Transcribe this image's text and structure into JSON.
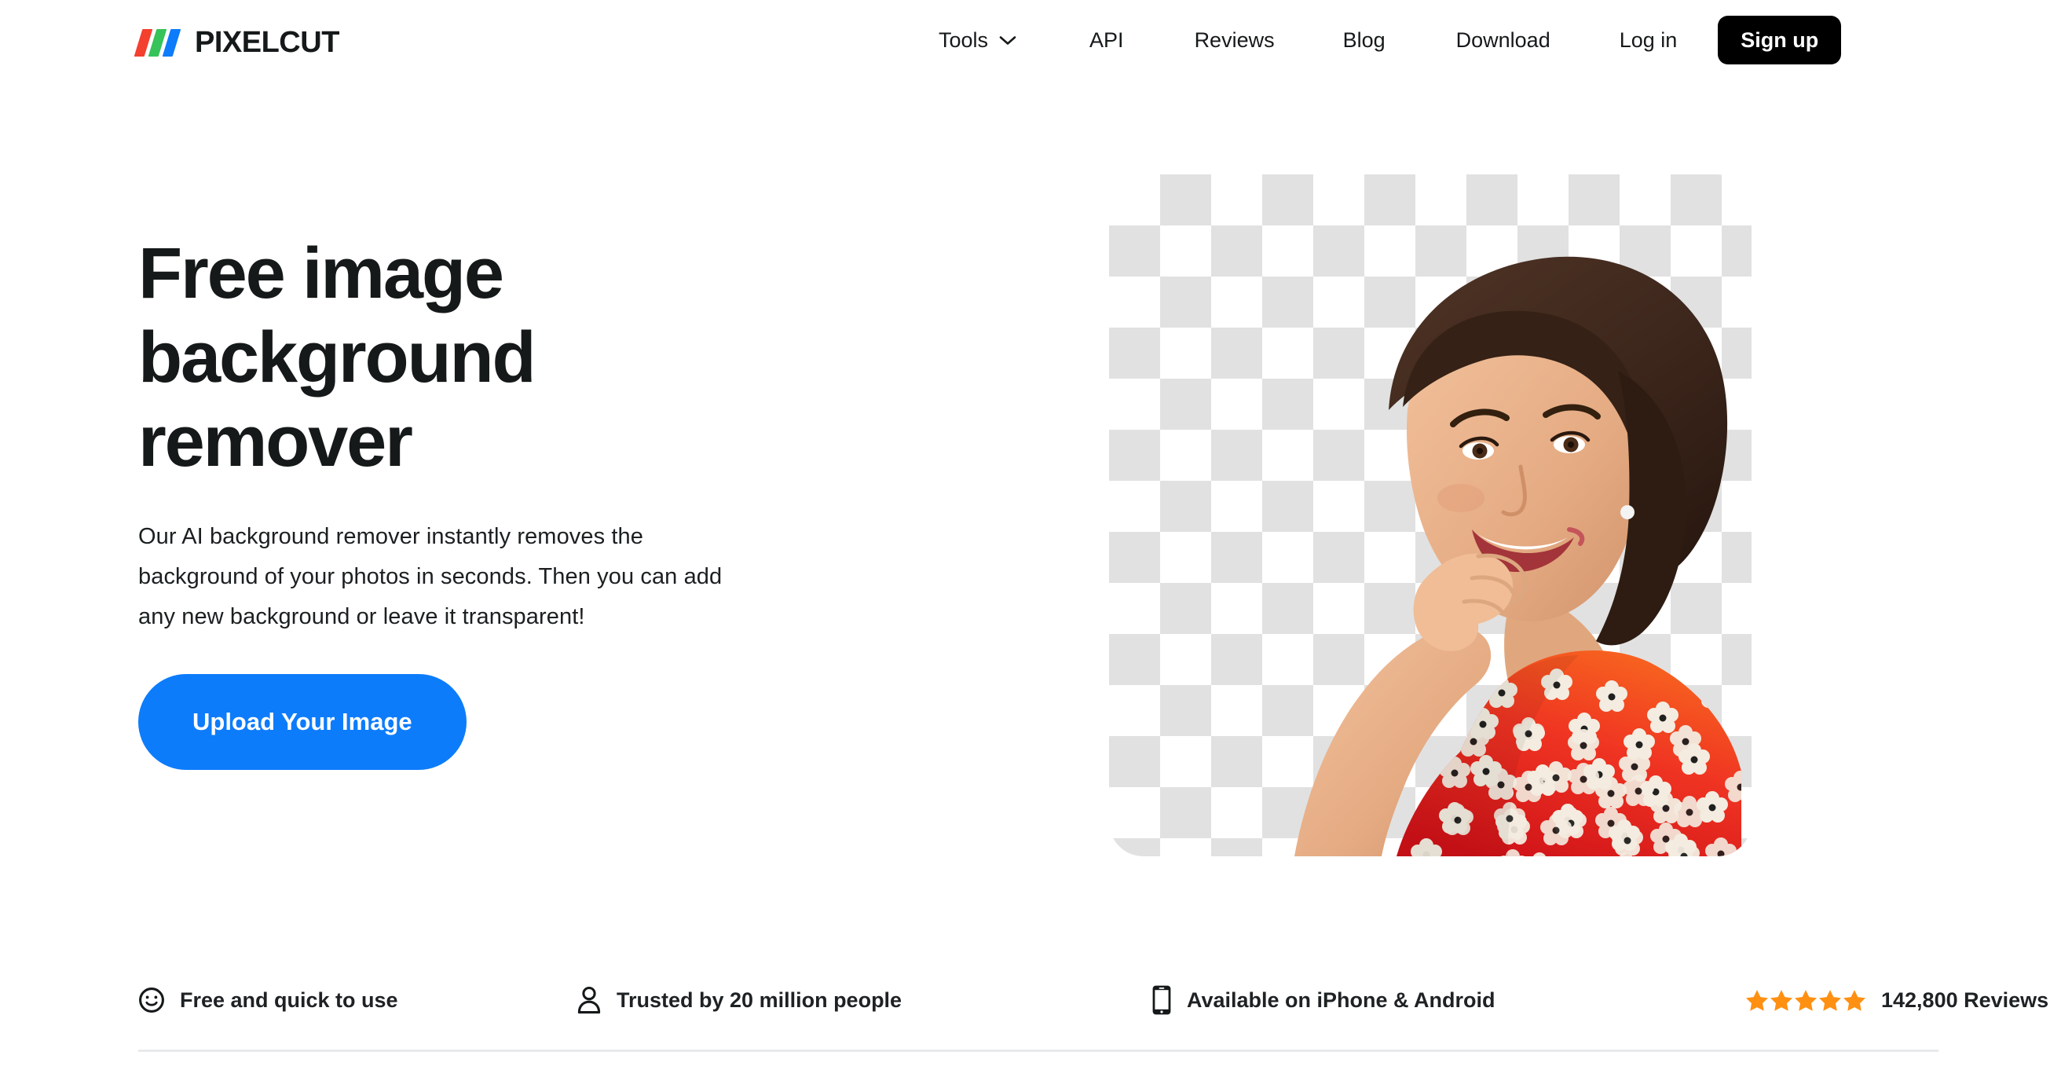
{
  "brand": {
    "name": "PIXELCUT",
    "logo_colors": [
      "#f4402f",
      "#36c35a",
      "#0d7cfb"
    ]
  },
  "header": {
    "nav": [
      {
        "label": "Tools",
        "has_dropdown": true,
        "icon": "chevron-down-icon"
      },
      {
        "label": "API",
        "has_dropdown": false
      },
      {
        "label": "Reviews",
        "has_dropdown": false
      },
      {
        "label": "Blog",
        "has_dropdown": false
      },
      {
        "label": "Download",
        "has_dropdown": false
      },
      {
        "label": "Log in",
        "has_dropdown": false
      }
    ],
    "signup_label": "Sign up",
    "signup_bg": "#000000"
  },
  "hero": {
    "title": "Free image\nbackground\nremover",
    "subtitle": "Our AI background remover instantly removes the\nbackground of your photos in seconds. Then you can add\nany new background or leave it transparent!",
    "cta_label": "Upload Your Image",
    "cta_color": "#0d7cfb",
    "image_alt": "Smiling woman with short brown hair in red and orange floral dress on transparent checkerboard background"
  },
  "features": [
    {
      "icon": "smiley-face-icon",
      "label": "Free and quick to use"
    },
    {
      "icon": "person-icon",
      "label": "Trusted by 20 million people"
    },
    {
      "icon": "phone-icon",
      "label": "Available on iPhone & Android"
    },
    {
      "icon": "star-rating-icon",
      "label": "142,800 Reviews",
      "stars": 5,
      "star_color": "#ff9012"
    }
  ]
}
